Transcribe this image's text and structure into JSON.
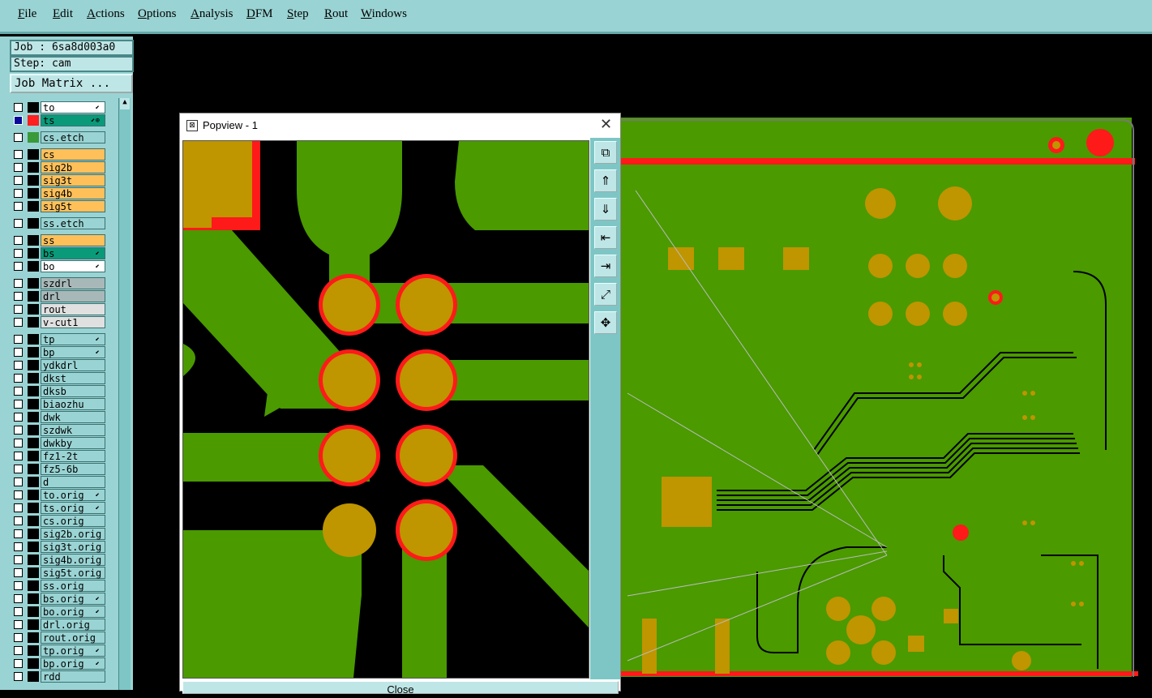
{
  "menu": [
    "File",
    "Edit",
    "Actions",
    "Options",
    "Analysis",
    "DFM",
    "Step",
    "Rout",
    "Windows"
  ],
  "job_label": "Job : 6sa8d003a0",
  "step_label": "Step: cam",
  "job_matrix_button": "Job Matrix ...",
  "layers": [
    {
      "name": "to",
      "color": "#ffffff",
      "swatch": "#000000",
      "arrow": "⬋",
      "selected": false
    },
    {
      "name": "ts",
      "color": "#0a9a7a",
      "swatch": "#ff2020",
      "arrow": "⬋⊕",
      "selected": true
    },
    {
      "name": "cs.etch",
      "color": "#9ad3d3",
      "swatch": "#3a9a3a",
      "arrow": "",
      "selected": false,
      "gap": true
    },
    {
      "name": "cs",
      "color": "#ffc05a",
      "swatch": "#000000",
      "arrow": "",
      "selected": false,
      "gap": true
    },
    {
      "name": "sig2b",
      "color": "#ffc05a",
      "swatch": "#000000",
      "arrow": "",
      "selected": false
    },
    {
      "name": "sig3t",
      "color": "#ffc05a",
      "swatch": "#000000",
      "arrow": "",
      "selected": false
    },
    {
      "name": "sig4b",
      "color": "#ffc05a",
      "swatch": "#000000",
      "arrow": "",
      "selected": false
    },
    {
      "name": "sig5t",
      "color": "#ffc05a",
      "swatch": "#000000",
      "arrow": "",
      "selected": false
    },
    {
      "name": "ss.etch",
      "color": "#9ad3d3",
      "swatch": "#000000",
      "arrow": "",
      "selected": false,
      "gap": true
    },
    {
      "name": "ss",
      "color": "#ffc05a",
      "swatch": "#000000",
      "arrow": "",
      "selected": false,
      "gap": true
    },
    {
      "name": "bs",
      "color": "#0a9a7a",
      "swatch": "#000000",
      "arrow": "⬋",
      "selected": false
    },
    {
      "name": "bo",
      "color": "#ffffff",
      "swatch": "#000000",
      "arrow": "⬋",
      "selected": false
    },
    {
      "name": "szdrl",
      "color": "#a8b8b8",
      "swatch": "#000000",
      "arrow": "",
      "selected": false,
      "gap": true
    },
    {
      "name": "drl",
      "color": "#a8b8b8",
      "swatch": "#000000",
      "arrow": "",
      "selected": false
    },
    {
      "name": "rout",
      "color": "#e0e0e0",
      "swatch": "#000000",
      "arrow": "",
      "selected": false
    },
    {
      "name": "v-cut1",
      "color": "#e0e0e0",
      "swatch": "#000000",
      "arrow": "",
      "selected": false
    },
    {
      "name": "tp",
      "color": "#9ad3d3",
      "swatch": "#000000",
      "arrow": "⬋",
      "selected": false,
      "gap": true
    },
    {
      "name": "bp",
      "color": "#9ad3d3",
      "swatch": "#000000",
      "arrow": "⬋",
      "selected": false
    },
    {
      "name": "ydkdrl",
      "color": "#9ad3d3",
      "swatch": "#000000",
      "arrow": "",
      "selected": false
    },
    {
      "name": "dkst",
      "color": "#9ad3d3",
      "swatch": "#000000",
      "arrow": "",
      "selected": false
    },
    {
      "name": "dksb",
      "color": "#9ad3d3",
      "swatch": "#000000",
      "arrow": "",
      "selected": false
    },
    {
      "name": "biaozhu",
      "color": "#9ad3d3",
      "swatch": "#000000",
      "arrow": "",
      "selected": false
    },
    {
      "name": "dwk",
      "color": "#9ad3d3",
      "swatch": "#000000",
      "arrow": "",
      "selected": false
    },
    {
      "name": "szdwk",
      "color": "#9ad3d3",
      "swatch": "#000000",
      "arrow": "",
      "selected": false
    },
    {
      "name": "dwkby",
      "color": "#9ad3d3",
      "swatch": "#000000",
      "arrow": "",
      "selected": false
    },
    {
      "name": "fz1-2t",
      "color": "#9ad3d3",
      "swatch": "#000000",
      "arrow": "",
      "selected": false
    },
    {
      "name": "fz5-6b",
      "color": "#9ad3d3",
      "swatch": "#000000",
      "arrow": "",
      "selected": false
    },
    {
      "name": "d",
      "color": "#9ad3d3",
      "swatch": "#000000",
      "arrow": "",
      "selected": false
    },
    {
      "name": "to.orig",
      "color": "#9ad3d3",
      "swatch": "#000000",
      "arrow": "⬋",
      "selected": false
    },
    {
      "name": "ts.orig",
      "color": "#9ad3d3",
      "swatch": "#000000",
      "arrow": "⬋",
      "selected": false
    },
    {
      "name": "cs.orig",
      "color": "#9ad3d3",
      "swatch": "#000000",
      "arrow": "",
      "selected": false
    },
    {
      "name": "sig2b.orig",
      "color": "#9ad3d3",
      "swatch": "#000000",
      "arrow": "",
      "selected": false
    },
    {
      "name": "sig3t.orig",
      "color": "#9ad3d3",
      "swatch": "#000000",
      "arrow": "",
      "selected": false
    },
    {
      "name": "sig4b.orig",
      "color": "#9ad3d3",
      "swatch": "#000000",
      "arrow": "",
      "selected": false
    },
    {
      "name": "sig5t.orig",
      "color": "#9ad3d3",
      "swatch": "#000000",
      "arrow": "",
      "selected": false
    },
    {
      "name": "ss.orig",
      "color": "#9ad3d3",
      "swatch": "#000000",
      "arrow": "",
      "selected": false
    },
    {
      "name": "bs.orig",
      "color": "#9ad3d3",
      "swatch": "#000000",
      "arrow": "⬋",
      "selected": false
    },
    {
      "name": "bo.orig",
      "color": "#9ad3d3",
      "swatch": "#000000",
      "arrow": "⬋",
      "selected": false
    },
    {
      "name": "drl.orig",
      "color": "#9ad3d3",
      "swatch": "#000000",
      "arrow": "",
      "selected": false
    },
    {
      "name": "rout.orig",
      "color": "#9ad3d3",
      "swatch": "#000000",
      "arrow": "",
      "selected": false
    },
    {
      "name": "tp.orig",
      "color": "#9ad3d3",
      "swatch": "#000000",
      "arrow": "⬋",
      "selected": false
    },
    {
      "name": "bp.orig",
      "color": "#9ad3d3",
      "swatch": "#000000",
      "arrow": "⬋",
      "selected": false
    },
    {
      "name": "rdd",
      "color": "#9ad3d3",
      "swatch": "#000000",
      "arrow": "",
      "selected": false
    }
  ],
  "popview": {
    "title": "Popview - 1",
    "close_glyph": "✕",
    "close_button": "Close",
    "tools": [
      "zoom-window-icon",
      "zoom-in-icon",
      "zoom-out-icon",
      "pan-left-icon",
      "pan-right-icon",
      "zoom-fit-icon",
      "pan-all-icon"
    ]
  },
  "colors": {
    "copper": "#bf9500",
    "mask": "#4a9a00",
    "pad_ring": "#ff1a1a",
    "panel": "#9ad3d3"
  }
}
